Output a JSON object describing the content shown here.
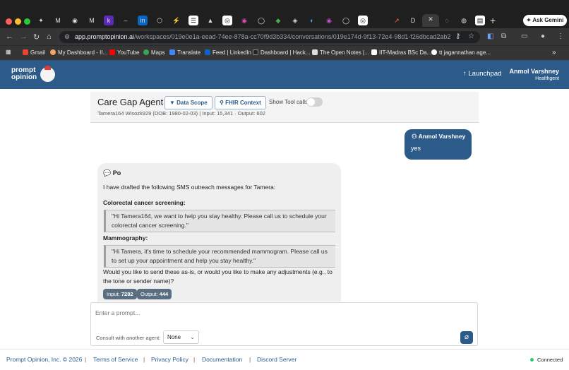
{
  "browser": {
    "url_domain": "app.promptopinion.ai",
    "url_path": "/workspaces/019e0e1a-eead-74ee-878a-cc70f9d3b334/conversations/019e174d-9f13-72e4-98d1-f26dbcad2ab2",
    "ask_gemini": "Ask Gemini",
    "bookmarks": [
      "Gmail",
      "My Dashboard - II...",
      "YouTube",
      "Maps",
      "Translate",
      "Feed | LinkedIn",
      "Dashboard | Hack...",
      "The Open Notes |...",
      "IIT-Madras BSc Da...",
      "tt jagannathan age..."
    ]
  },
  "header": {
    "logo_line1": "prompt",
    "logo_line2": "opinion",
    "launchpad": "Launchpad",
    "user_name": "Anmol Varshney",
    "user_org": "Healthgent"
  },
  "agent": {
    "title": "Care Gap Agent",
    "data_scope": "Data Scope",
    "fhir_context": "FHIR Context",
    "show_tool_calls": "Show Tool calls",
    "patient_line": "Tamera164 Wisozk929 (DOB: 1980-02-03)  | Input: 15,341 · Output: 602"
  },
  "chat": {
    "user": {
      "name": "Anmol Varshney",
      "text": "yes"
    },
    "bot": {
      "name": "Po",
      "intro": "I have drafted the following SMS outreach messages for Tamera:",
      "heading1": "Colorectal cancer screening:",
      "quote1": "\"Hi Tamera164, we want to help you stay healthy. Please call us to schedule your colorectal cancer screening.\"",
      "heading2": "Mammography:",
      "quote2": "\"Hi Tamera, it's time to schedule your recommended mammogram. Please call us to set up your appointment and help you stay healthy.\"",
      "question": "Would you like to send these as-is, or would you like to make any adjustments (e.g., to the tone or sender name)?",
      "input_label": "Input:",
      "input_tokens": "7282",
      "output_label": "Output:",
      "output_tokens": "444"
    }
  },
  "composer": {
    "placeholder": "Enter a prompt...",
    "consult_label": "Consult with another agent:",
    "consult_value": "None"
  },
  "footer": {
    "copyright": "Prompt Opinion, Inc. © 2026",
    "terms": "Terms of Service",
    "privacy": "Privacy Policy",
    "docs": "Documentation",
    "discord": "Discord Server",
    "status": "Connected"
  },
  "colors": {
    "brand": "#2c5b8a",
    "status_ok": "#2ecc71"
  }
}
